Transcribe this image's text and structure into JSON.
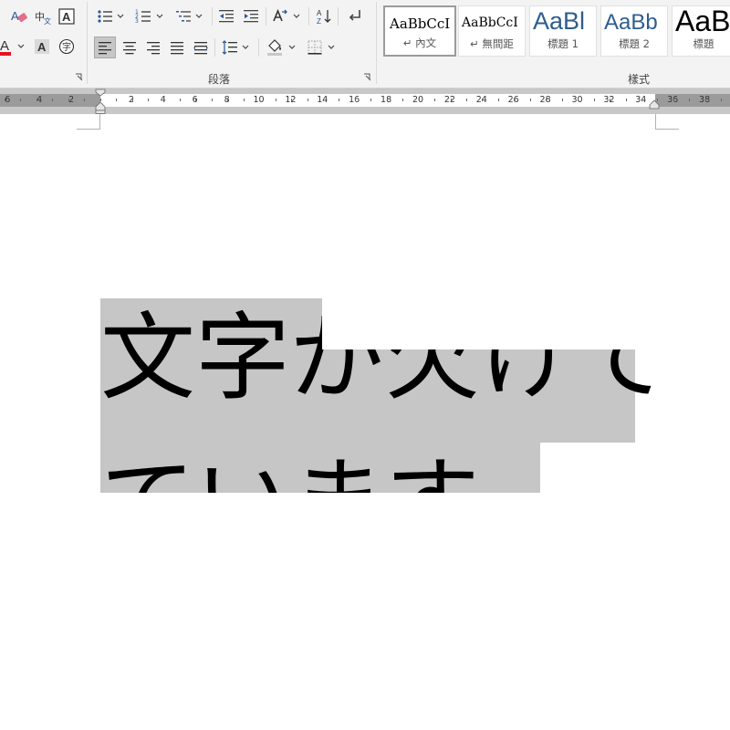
{
  "ribbon": {
    "paragraph_group_label": "段落",
    "styles_group_label": "樣式",
    "font_tools": {
      "phonetic_label": "中",
      "phonetic_sub": "文",
      "char_border_label": "A",
      "font_color_label": "A",
      "char_shading_label": "A",
      "enclose_char_label": "字",
      "font_color": "#e81123"
    },
    "paragraph_tools": {
      "sort_label_top": "A",
      "sort_label_bottom": "Z"
    },
    "styles": [
      {
        "sample": "AaBbCcI",
        "name": "↵ 內文",
        "selected": true,
        "color": "#000000",
        "size": "15px",
        "font": "serif"
      },
      {
        "sample": "AaBbCcI",
        "name": "↵ 無間距",
        "selected": false,
        "color": "#000000",
        "size": "15px",
        "font": "serif"
      },
      {
        "sample": "AaBl",
        "name": "標題 1",
        "selected": false,
        "color": "#2e5d8f",
        "size": "27px",
        "font": "sans"
      },
      {
        "sample": "AaBb",
        "name": "標題 2",
        "selected": false,
        "color": "#2e5d8f",
        "size": "24px",
        "font": "sans"
      },
      {
        "sample": "AaB",
        "name": "標題",
        "selected": false,
        "color": "#000000",
        "size": "32px",
        "font": "sans"
      }
    ]
  },
  "ruler": {
    "labels": [
      "6",
      "4",
      "2",
      "2",
      "4",
      "6",
      "8",
      "10",
      "12",
      "14",
      "16",
      "18",
      "20",
      "22",
      "24",
      "26",
      "28",
      "30",
      "32",
      "34",
      "36",
      "38"
    ]
  },
  "document": {
    "line1": "文字が欠けて",
    "line2": "ています"
  }
}
